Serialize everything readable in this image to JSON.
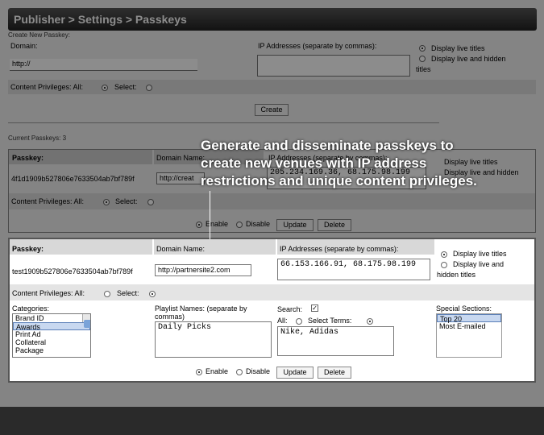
{
  "header": {
    "title": "Publisher > Settings > Passkeys"
  },
  "create": {
    "section_label": "Create New Passkey:",
    "domain_label": "Domain:",
    "domain_value": "http://",
    "ip_label": "IP Addresses (separate by commas):",
    "ip_value": "",
    "display_live": "Display live titles",
    "display_live_hidden": "Display live and hidden",
    "titles_word": "titles",
    "privileges_label": "Content Privileges:  All:",
    "select_label": "Select:",
    "create_button": "Create"
  },
  "current": {
    "count_label": "Current Passkeys: 3",
    "col_passkey": "Passkey:",
    "col_domain": "Domain Name:",
    "col_ip": "IP Addresses (separate by commas):",
    "row1": {
      "passkey": "4f1d1909b527806e7633504ab7bf789f",
      "domain": "http://creat",
      "ip": "205.234.169.36, 68.175.98.199",
      "display_live": "Display live titles",
      "display_live_hidden": "Display live and hidden",
      "privileges_label": "Content Privileges:  All:",
      "select_label": "Select:",
      "enable": "Enable",
      "disable": "Disable",
      "update": "Update",
      "delete": "Delete"
    }
  },
  "highlight": {
    "col_passkey": "Passkey:",
    "col_domain": "Domain Name:",
    "col_ip": "IP Addresses (separate by commas):",
    "passkey": "test1909b527806e7633504ab7bf789f",
    "domain": "http://partnersite2.com",
    "ip": "66.153.166.91, 68.175.98.199",
    "display_live": "Display live titles",
    "display_live_hidden_1": "Display live and",
    "display_live_hidden_2": "hidden titles",
    "privileges_label": "Content Privileges:  All:",
    "select_label": "Select:",
    "categories_label": "Categories:",
    "categories": [
      "Brand ID",
      "Awards",
      "Print Ad",
      "Collateral",
      "Package"
    ],
    "categories_selected": "Awards",
    "playlist_label_1": "Playlist Names: (separate by",
    "playlist_label_2": "commas)",
    "playlist_value": "Daily Picks",
    "search_label": "Search:",
    "search_all": "All:",
    "search_terms": "Select Terms:",
    "search_value": "Nike, Adidas",
    "special_label": "Special Sections:",
    "special_items": [
      "Top 20",
      "Most E-mailed"
    ],
    "special_selected": "Top 20",
    "enable": "Enable",
    "disable": "Disable",
    "update": "Update",
    "delete": "Delete"
  },
  "caption": {
    "line1": "Generate and disseminate passkeys to",
    "line2": "create new venues with IP address",
    "line3": "restrictions and unique content privileges."
  }
}
